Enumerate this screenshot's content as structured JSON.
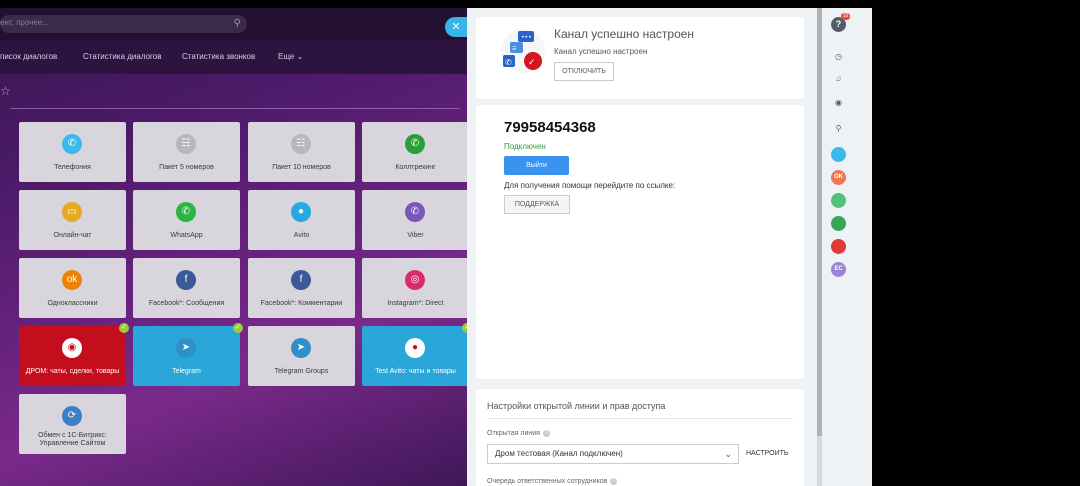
{
  "background": {
    "search_placeholder": "ент, прочее...",
    "nav": [
      "писок диалогов",
      "Статистика диалогов",
      "Статистика звонков",
      "Еще"
    ],
    "tiles": [
      {
        "label": "Телефония",
        "icon": "phone-icon",
        "color": "#3bb9e9"
      },
      {
        "label": "Пакет 5 номеров",
        "icon": "phone-pack-icon",
        "color": "#b5b8bf"
      },
      {
        "label": "Пакет 10 номеров",
        "icon": "phone-pack-icon",
        "color": "#b5b8bf"
      },
      {
        "label": "Коллтрекинг",
        "icon": "calltracking-icon",
        "color": "#2a9d3c"
      },
      {
        "label": "Онлайн-чат",
        "icon": "chat-icon",
        "color": "#e4a91f"
      },
      {
        "label": "WhatsApp",
        "icon": "whatsapp-icon",
        "color": "#2bb441"
      },
      {
        "label": "Avito",
        "icon": "avito-icon",
        "color": "#28a9e0"
      },
      {
        "label": "Viber",
        "icon": "viber-icon",
        "color": "#7b55b8"
      },
      {
        "label": "Одноклассники",
        "icon": "odnoklassniki-icon",
        "color": "#ee8208"
      },
      {
        "label": "Facebook*: Сообщения",
        "icon": "facebook-icon",
        "color": "#3b5998"
      },
      {
        "label": "Facebook*: Комментарии",
        "icon": "facebook-comments-icon",
        "color": "#3b5998"
      },
      {
        "label": "Instagram*: Direct",
        "icon": "instagram-icon",
        "color": "#d92c70"
      },
      {
        "label": "ДРОМ: чаты, сделки, товары",
        "icon": "drom-icon",
        "color": "#ffffff"
      },
      {
        "label": "Telegram",
        "icon": "telegram-icon",
        "color": "#2e90c8"
      },
      {
        "label": "Telegram Groups",
        "icon": "telegram-icon",
        "color": "#2e90c8"
      },
      {
        "label": "Test Avito: чаты и товары",
        "icon": "avito-icon",
        "color": "#ffffff"
      },
      {
        "label": "Обмен с 1С-Битрикс: Управление Сайтом",
        "icon": "bitrix-exchange-icon",
        "color": "#3d7fc4"
      }
    ]
  },
  "card1": {
    "title": "Канал успешно настроен",
    "subtitle": "Канал успешно настроен",
    "disconnect_label": "ОТКЛЮЧИТЬ"
  },
  "card2": {
    "phone": "79958454368",
    "status": "Подключен",
    "logout_label": "Выйти",
    "help_text": "Для получения помощи перейдите по ссылке:",
    "support_label": "ПОДДЕРЖКА"
  },
  "card3": {
    "title": "Настройки открытой линии и прав доступа",
    "line_label": "Открытая линия",
    "line_value": "Дром тестовая (Канал подключен)",
    "configure_label": "НАСТРОИТЬ",
    "queue_label": "Очередь ответственных сотрудников"
  },
  "sidebar": {
    "help_badge": "10",
    "help_glyph": "?",
    "avatars": [
      {
        "text": "",
        "color": "#3bb9e9"
      },
      {
        "text": "OK",
        "color": "#f07650"
      },
      {
        "text": "",
        "color": "#52c27a"
      },
      {
        "text": "",
        "color": "#3aa35a"
      },
      {
        "text": "",
        "color": "#e23a3a"
      },
      {
        "text": "EC",
        "color": "#9a84d6"
      }
    ]
  }
}
